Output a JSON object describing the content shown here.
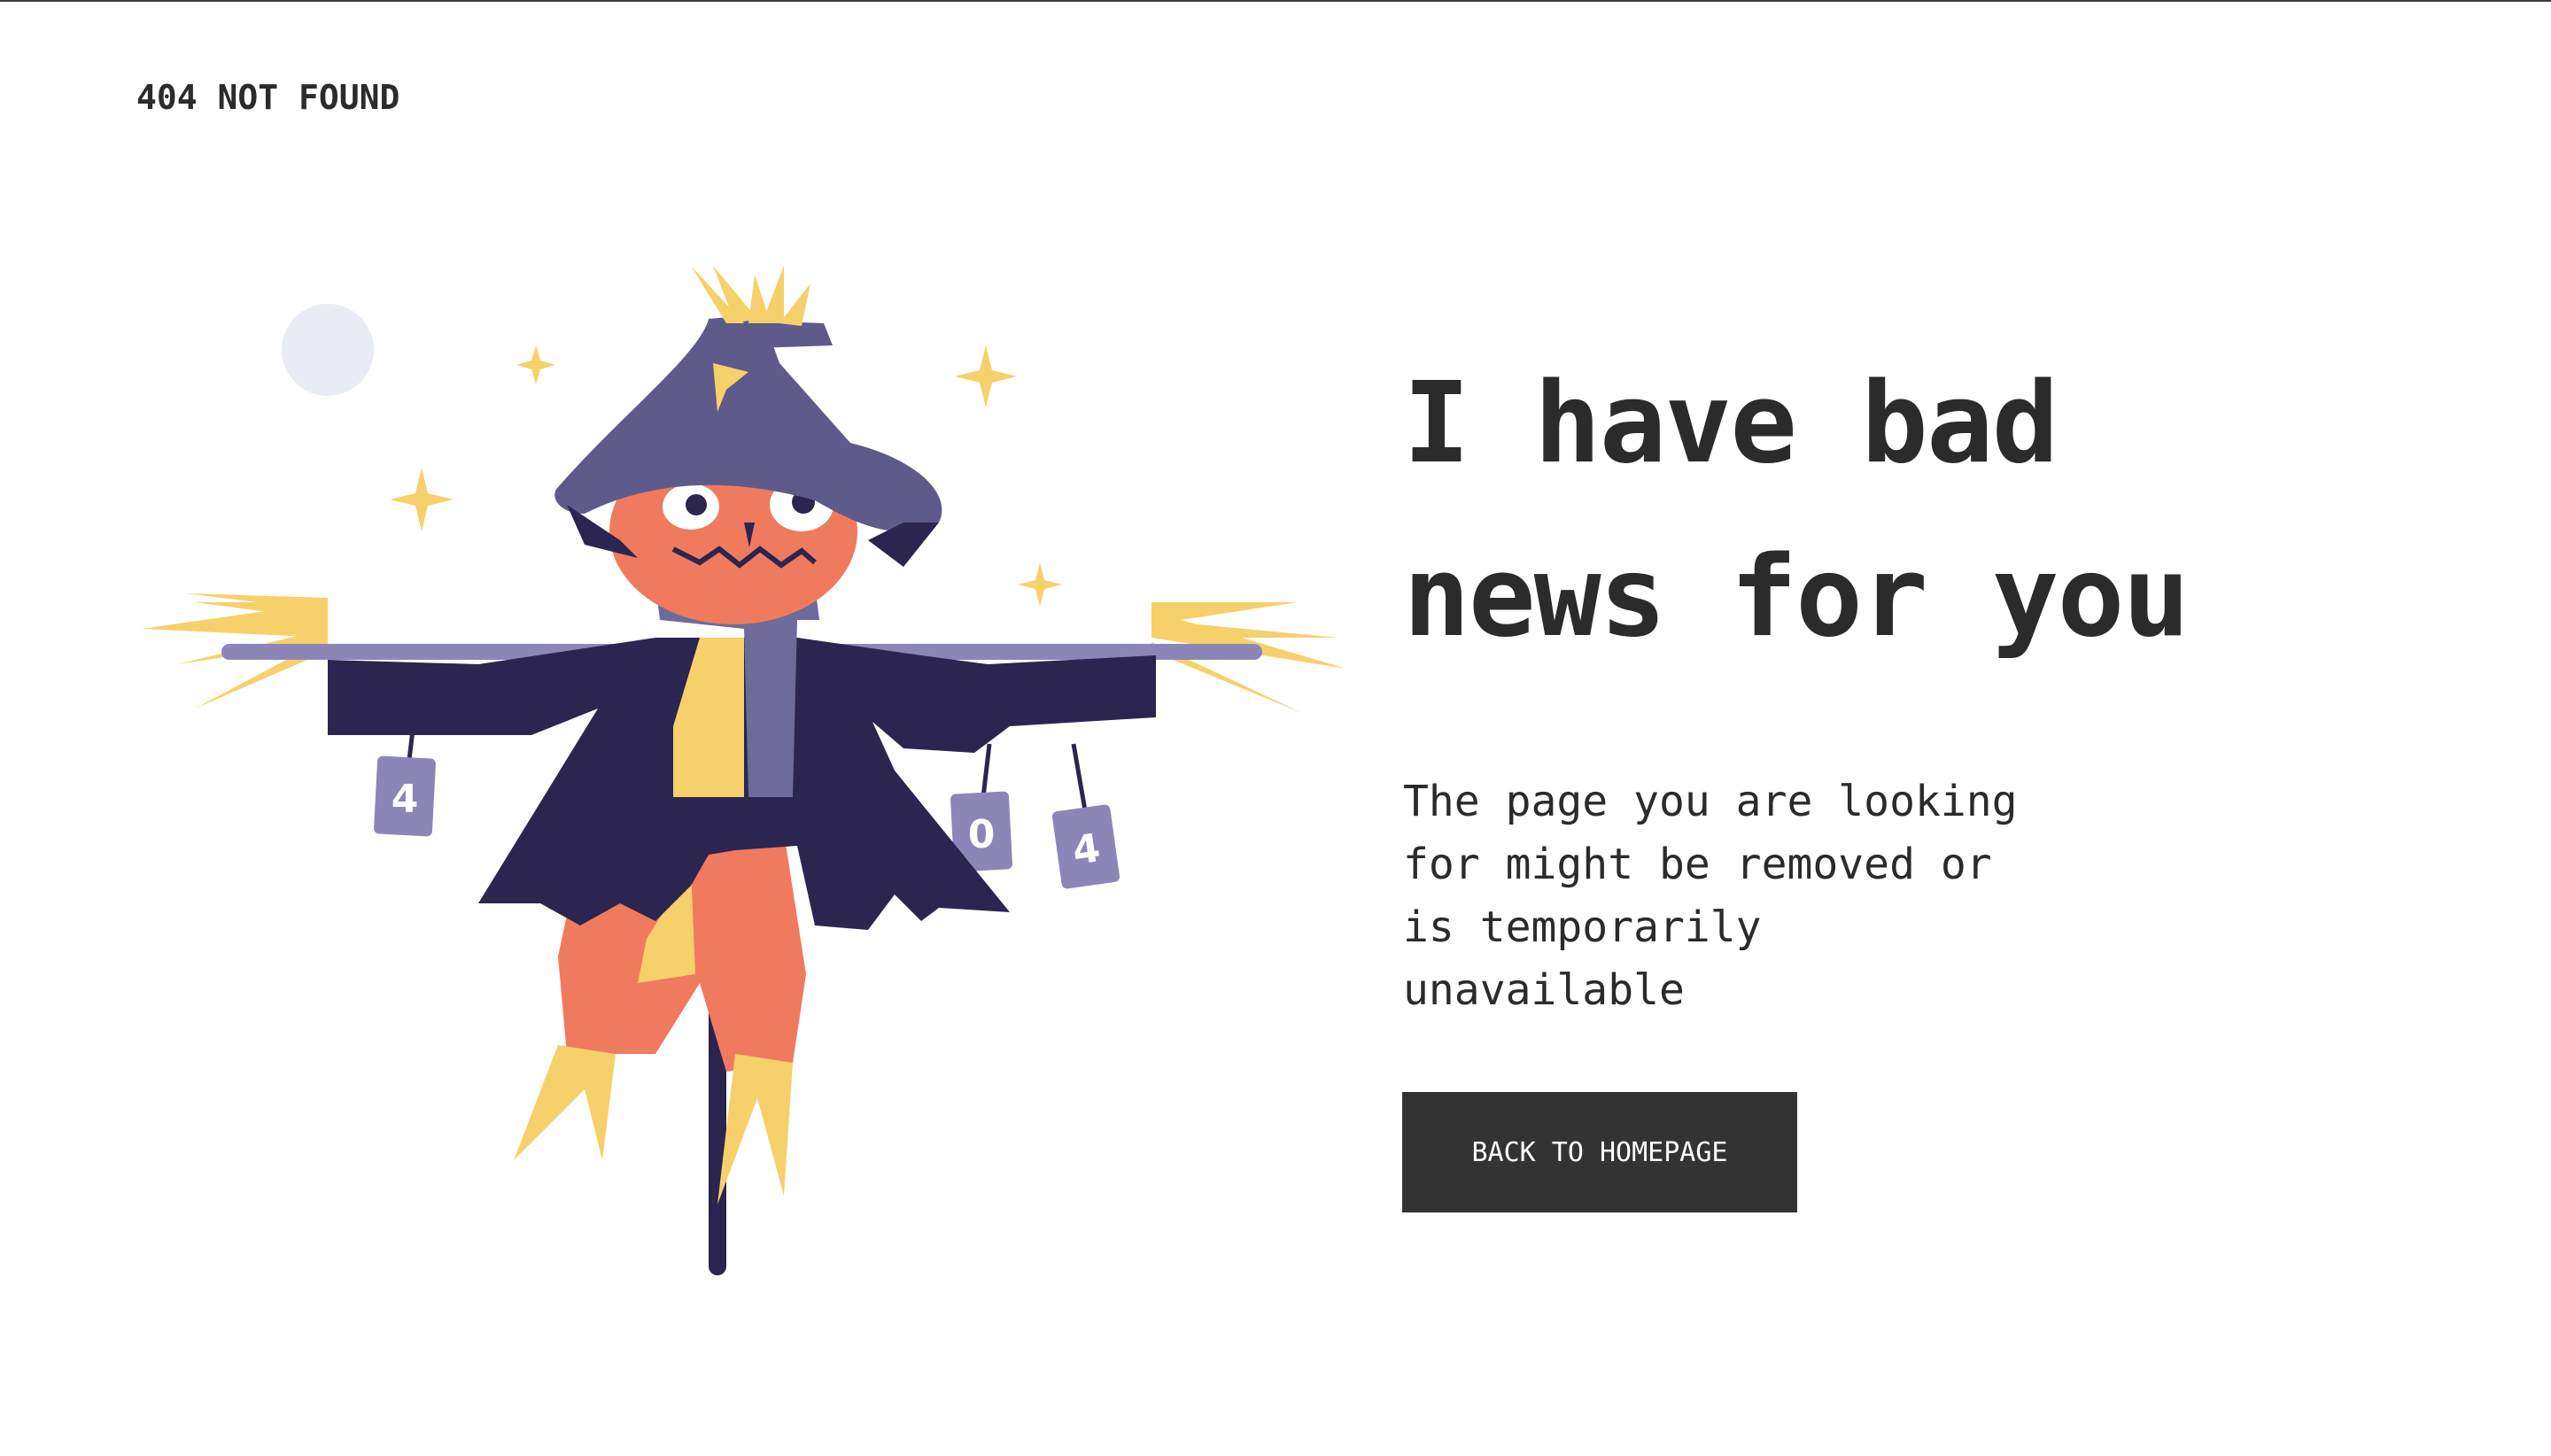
{
  "header": {
    "brand_label": "404 NOT FOUND"
  },
  "main": {
    "headline_line1": "I have bad",
    "headline_line2": "news for you",
    "message": "The page you are looking\nfor might be removed or\nis temporarily\nunavailable",
    "button_label": "BACK TO HOMEPAGE"
  },
  "illustration": {
    "can_labels": [
      "4",
      "0",
      "4"
    ]
  },
  "colors": {
    "text": "#2b2b2b",
    "button_bg": "#333333",
    "button_text": "#ffffff",
    "coat": "#2b2550",
    "hat": "#5f5a8c",
    "scarf": "#6e6a9a",
    "pumpkin": "#ef7a5e",
    "straw": "#f6d06b",
    "can": "#8c86b8",
    "moon": "#e9ecf4"
  }
}
